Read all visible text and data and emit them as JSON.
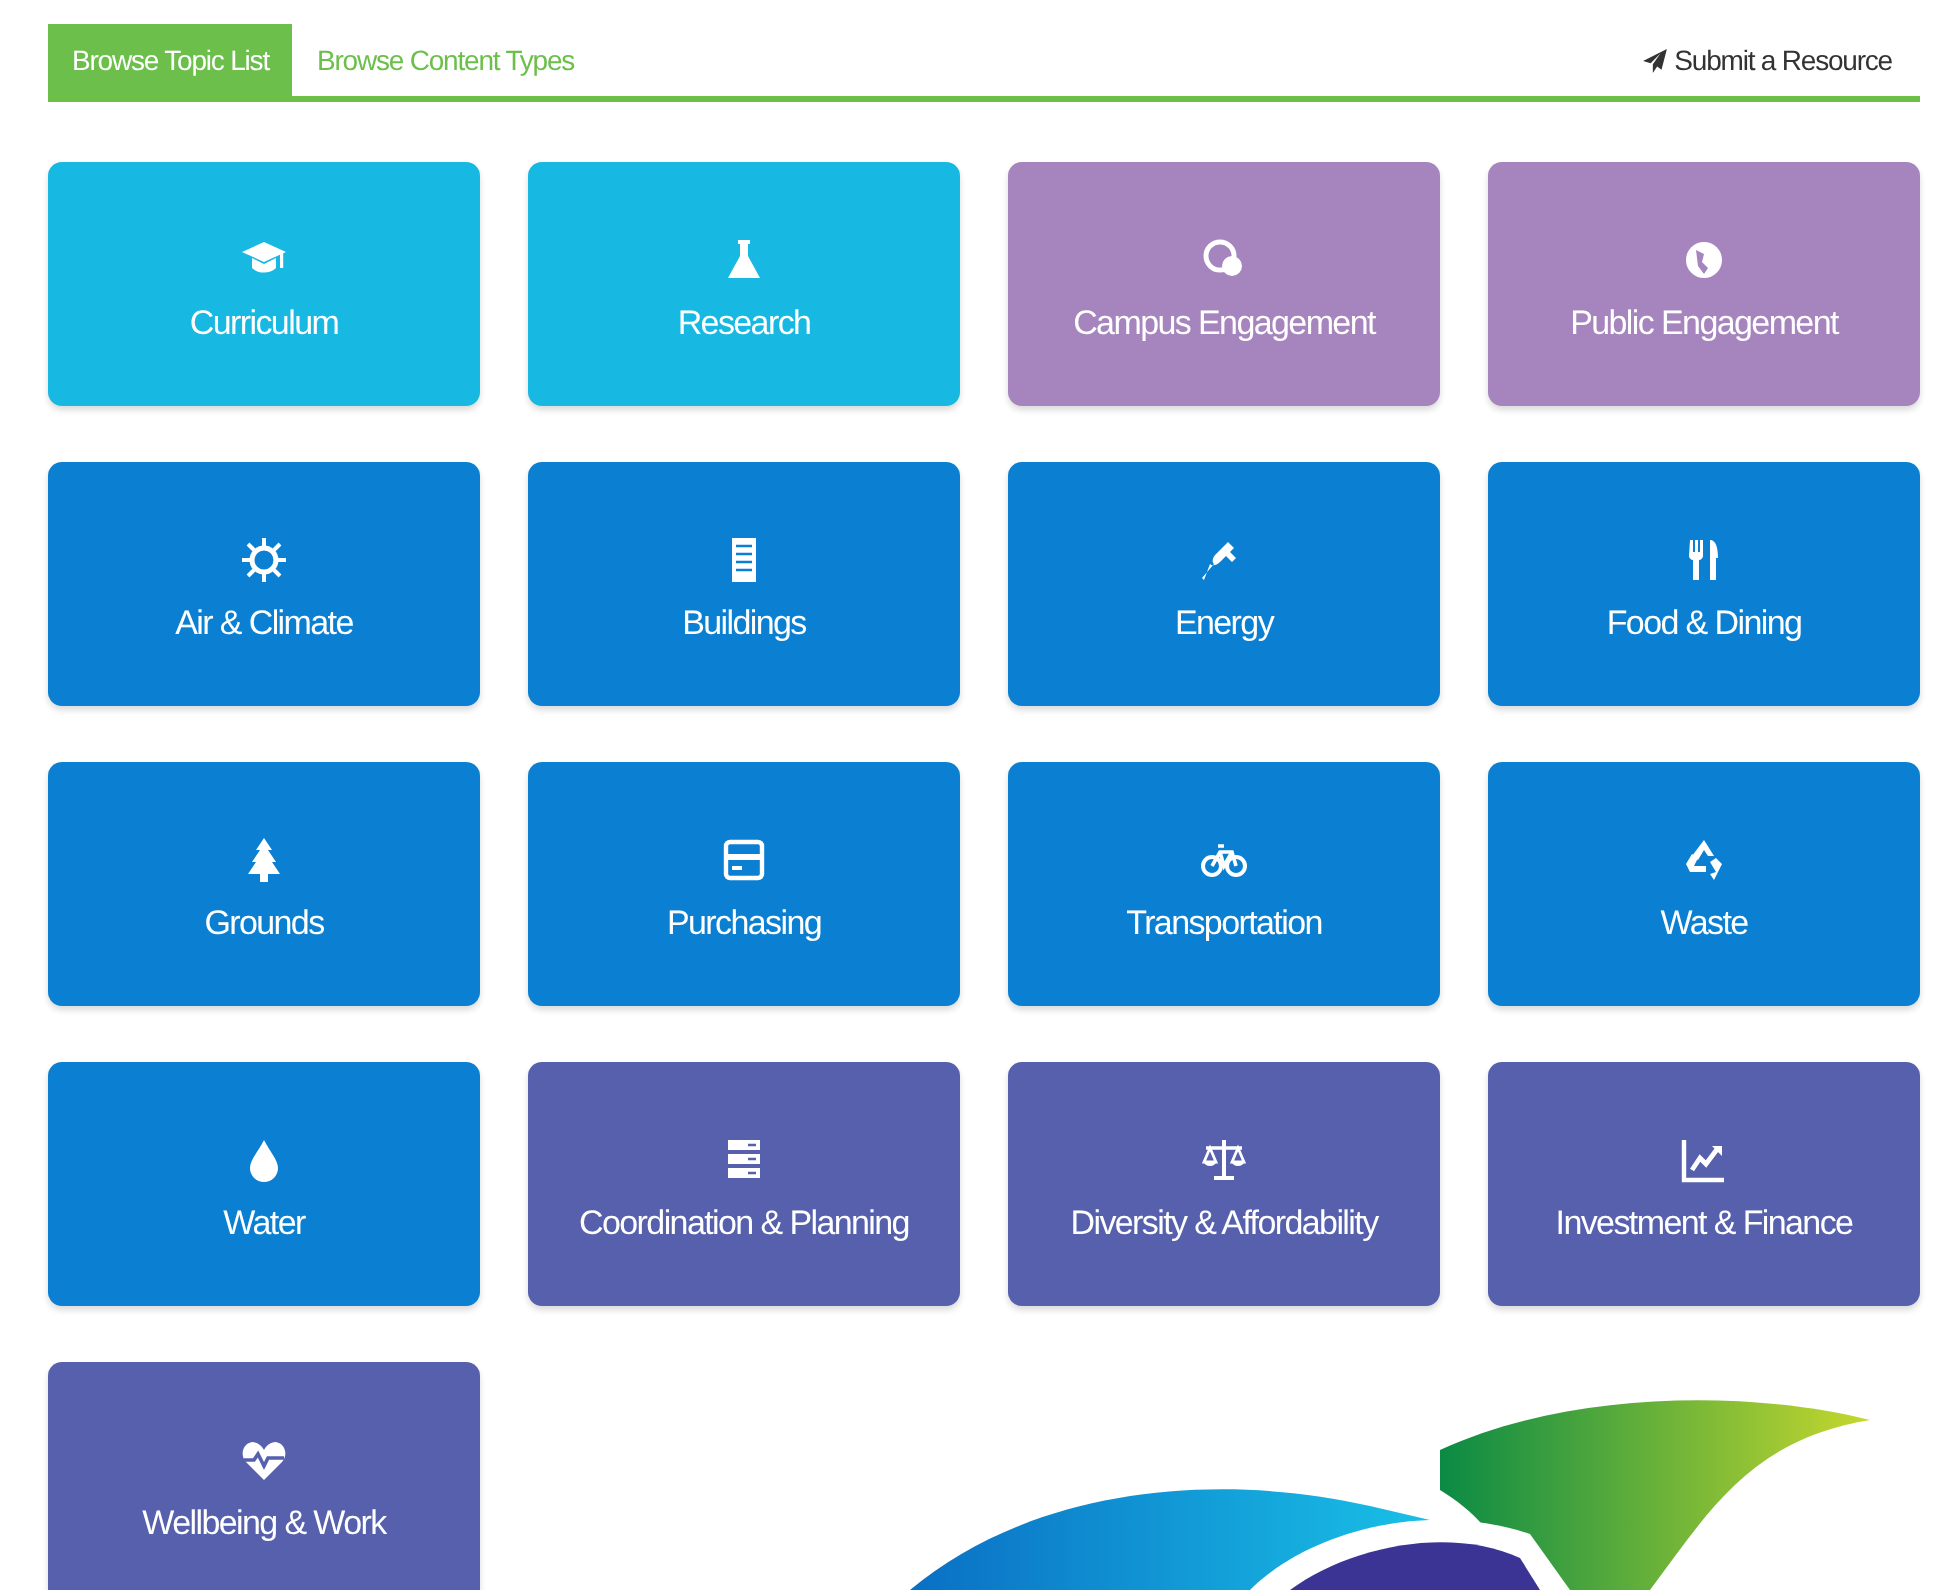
{
  "tabs": [
    {
      "label": "Browse Topic List",
      "selected": true
    },
    {
      "label": "Browse Content Types",
      "selected": false
    }
  ],
  "submit_link": {
    "label": "Submit a Resource"
  },
  "tiles": [
    {
      "label": "Curriculum",
      "color": "#17b8e2"
    },
    {
      "label": "Research",
      "color": "#17b8e2"
    },
    {
      "label": "Campus Engagement",
      "color": "#a684bd"
    },
    {
      "label": "Public Engagement",
      "color": "#a684bd"
    },
    {
      "label": "Air & Climate",
      "color": "#0b80d2"
    },
    {
      "label": "Buildings",
      "color": "#0b80d2"
    },
    {
      "label": "Energy",
      "color": "#0b80d2"
    },
    {
      "label": "Food & Dining",
      "color": "#0b80d2"
    },
    {
      "label": "Grounds",
      "color": "#0b80d2"
    },
    {
      "label": "Purchasing",
      "color": "#0b80d2"
    },
    {
      "label": "Transportation",
      "color": "#0b80d2"
    },
    {
      "label": "Waste",
      "color": "#0b80d2"
    },
    {
      "label": "Water",
      "color": "#0b80d2"
    },
    {
      "label": "Coordination & Planning",
      "color": "#5660ad"
    },
    {
      "label": "Diversity & Affordability",
      "color": "#5660ad"
    },
    {
      "label": "Investment & Finance",
      "color": "#5660ad"
    },
    {
      "label": "Wellbeing & Work",
      "color": "#5660ad"
    }
  ]
}
